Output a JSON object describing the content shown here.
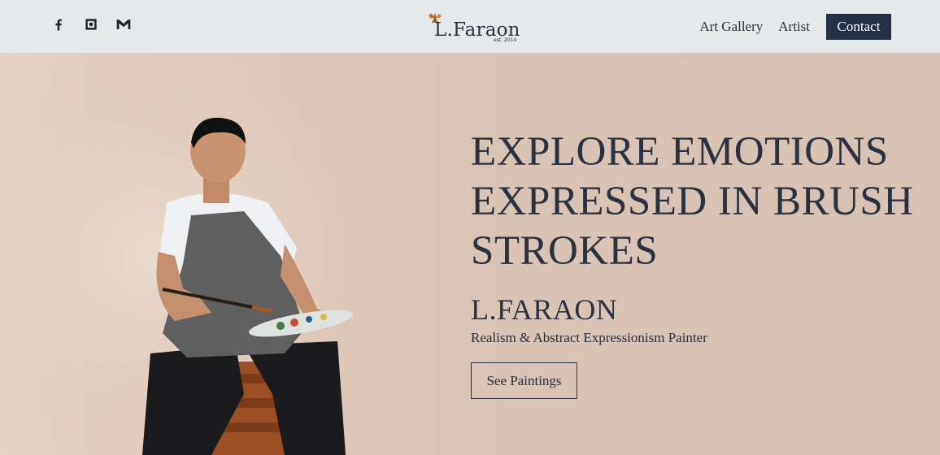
{
  "header": {
    "social": [
      {
        "icon": "facebook-icon"
      },
      {
        "icon": "instagram-icon"
      },
      {
        "icon": "gmail-icon"
      }
    ],
    "logo": {
      "name": "L.Faraon",
      "est": "est. 2014"
    },
    "nav": {
      "art_gallery": "Art Gallery",
      "artist": "Artist",
      "contact": "Contact"
    }
  },
  "hero": {
    "headline": "EXPLORE EMOTIONS EXPRESSED IN BRUSH STROKES",
    "artist_name": "L.FARAON",
    "tagline": "Realism & Abstract Expressionism Painter",
    "cta_label": "See Paintings"
  },
  "colors": {
    "header_bg": "#e5e9ea",
    "hero_bg": "#d8c3b4",
    "text": "#2a3140",
    "contact_bg": "#243045"
  }
}
